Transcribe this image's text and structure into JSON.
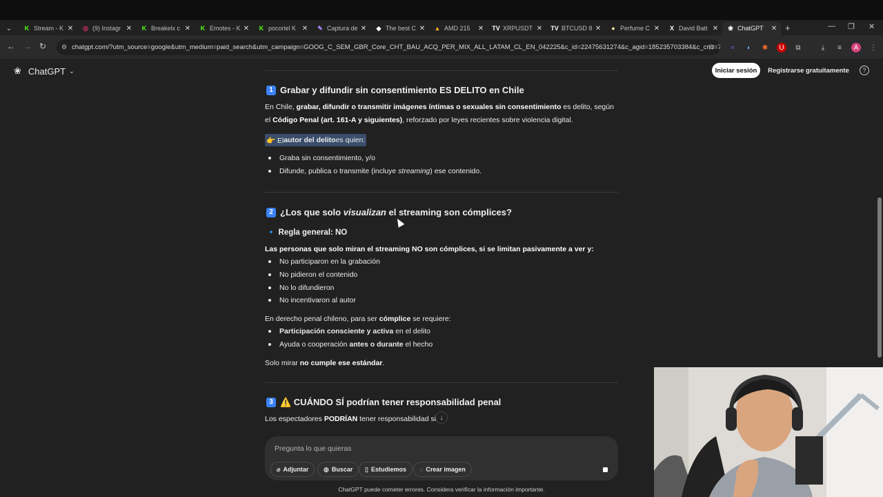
{
  "browser": {
    "tabs": [
      {
        "title": "Stream - K",
        "icon": "kick-icon",
        "color": "#53fc18",
        "glyph": "K"
      },
      {
        "title": "(9) Instagr",
        "icon": "instagram-icon",
        "color": "#e1306c",
        "glyph": "◎"
      },
      {
        "title": "Breakelx c",
        "icon": "kick-icon",
        "color": "#53fc18",
        "glyph": "K"
      },
      {
        "title": "Emotes - K",
        "icon": "kick-icon",
        "color": "#53fc18",
        "glyph": "K"
      },
      {
        "title": "pocoriel K",
        "icon": "kick-icon",
        "color": "#53fc18",
        "glyph": "K"
      },
      {
        "title": "Captura de",
        "icon": "pen-icon",
        "color": "#b48cff",
        "glyph": "✎"
      },
      {
        "title": "The best C",
        "icon": "diamond-icon",
        "color": "#ffffff",
        "glyph": "◆"
      },
      {
        "title": "AMD 215",
        "icon": "chart-icon",
        "color": "#f5a623",
        "glyph": "▲"
      },
      {
        "title": "XRPUSDT",
        "icon": "tradingview-icon",
        "color": "#ffffff",
        "glyph": "TV"
      },
      {
        "title": "BTCUSD 8",
        "icon": "tradingview-icon",
        "color": "#ffffff",
        "glyph": "TV"
      },
      {
        "title": "Perfume C",
        "icon": "perfume-icon",
        "color": "#f3e9a0",
        "glyph": "●"
      },
      {
        "title": "David Batt",
        "icon": "x-icon",
        "color": "#ffffff",
        "glyph": "X"
      },
      {
        "title": "ChatGPT",
        "icon": "chatgpt-icon",
        "color": "#ffffff",
        "glyph": "❀",
        "active": true
      }
    ],
    "url": "chatgpt.com/?utm_source=google&utm_medium=paid_search&utm_campaign=GOOG_C_SEM_GBR_Core_CHT_BAU_ACQ_PER_MIX_ALL_LATAM_CL_EN_042225&c_id=22475631274&c_agid=185235703384&c_crid=7478..."
  },
  "header": {
    "brand": "ChatGPT",
    "login": "Iniciar sesión",
    "signup": "Registrarse gratuitamente"
  },
  "section1": {
    "num": "1",
    "title": "Grabar y difundir sin consentimiento ES DELITO en Chile",
    "p1_a": "En Chile, ",
    "p1_b": "grabar, difundir o transmitir imágenes íntimas o sexuales sin consentimiento",
    "p1_c": " es delito, según el ",
    "p1_d": "Código Penal (art. 161-A y siguientes)",
    "p1_e": ", reforzado por leyes recientes sobre violencia digital.",
    "hl_a": "👉 El ",
    "hl_b": "autor del delito",
    "hl_c": " es quien:",
    "item1": "Graba sin consentimiento, y/o",
    "item2_a": "Difunde, publica o transmite (incluye ",
    "item2_b": "streaming",
    "item2_c": ") ese contenido."
  },
  "section2": {
    "num": "2",
    "title_a": "¿Los que solo ",
    "title_b": "visualizan",
    "title_c": " el streaming son cómplices?",
    "rule": "🔹 Regla general: NO",
    "lead": "Las personas que solo miran el streaming NO son cómplices, si se limitan pasivamente a ver y:",
    "items": [
      "No participaron en la grabación",
      "No pidieron el contenido",
      "No lo difundieron",
      "No incentivaron al autor"
    ],
    "req_a": "En derecho penal chileno, para ser ",
    "req_b": "cómplice",
    "req_c": " se requiere:",
    "r1_a": "Participación consciente y activa",
    "r1_b": " en el delito",
    "r2_a": "Ayuda o cooperación ",
    "r2_b": "antes o durante",
    "r2_c": " el hecho",
    "end_a": "Solo mirar ",
    "end_b": "no cumple ese estándar",
    "end_c": "."
  },
  "section3": {
    "num": "3",
    "title": "⚠️ CUÁNDO SÍ podrían tener responsabilidad penal",
    "p_a": "Los espectadores ",
    "p_b": "PODRÍAN",
    "p_c": " tener responsabilidad si:"
  },
  "composer": {
    "placeholder": "Pregunta lo que quieras",
    "attach": "Adjuntar",
    "search": "Buscar",
    "study": "Estudiemos",
    "image": "Crear imagen"
  },
  "footer": "ChatGPT puede cometer errores. Considera verificar la información importante."
}
